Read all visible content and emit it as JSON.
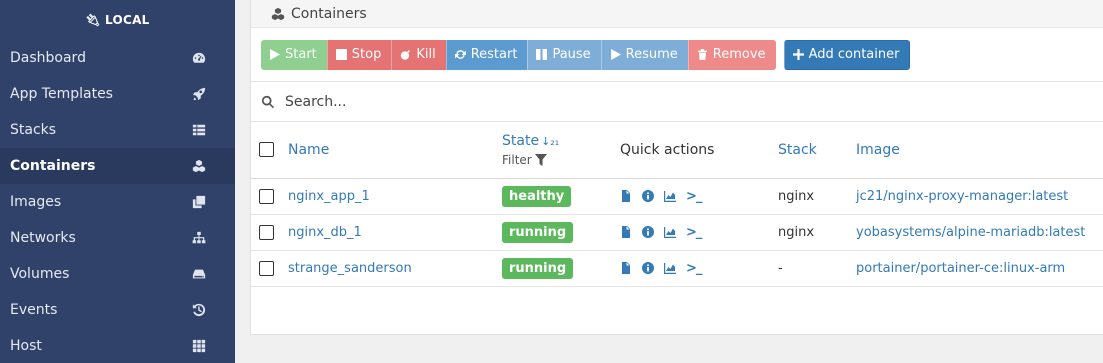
{
  "sidebar": {
    "endpoint": "LOCAL",
    "items": [
      {
        "label": "Dashboard",
        "icon": "dashboard-icon"
      },
      {
        "label": "App Templates",
        "icon": "rocket-icon"
      },
      {
        "label": "Stacks",
        "icon": "list-icon"
      },
      {
        "label": "Containers",
        "icon": "cubes-icon",
        "active": true
      },
      {
        "label": "Images",
        "icon": "clone-icon"
      },
      {
        "label": "Networks",
        "icon": "sitemap-icon"
      },
      {
        "label": "Volumes",
        "icon": "hdd-icon"
      },
      {
        "label": "Events",
        "icon": "history-icon"
      },
      {
        "label": "Host",
        "icon": "grid-icon"
      }
    ]
  },
  "widget": {
    "title": "Containers"
  },
  "actions": {
    "start": "Start",
    "stop": "Stop",
    "kill": "Kill",
    "restart": "Restart",
    "pause": "Pause",
    "resume": "Resume",
    "remove": "Remove",
    "add": "Add container"
  },
  "search": {
    "placeholder": "Search..."
  },
  "table": {
    "headers": {
      "name": "Name",
      "state": "State",
      "filter": "Filter",
      "quick_actions": "Quick actions",
      "stack": "Stack",
      "image": "Image"
    },
    "rows": [
      {
        "name": "nginx_app_1",
        "state": "healthy",
        "stack": "nginx",
        "image": "jc21/nginx-proxy-manager:latest"
      },
      {
        "name": "nginx_db_1",
        "state": "running",
        "stack": "nginx",
        "image": "yobasystems/alpine-mariadb:latest"
      },
      {
        "name": "strange_sanderson",
        "state": "running",
        "stack": "-",
        "image": "portainer/portainer-ce:linux-arm"
      }
    ]
  },
  "colors": {
    "sidebar_bg": "#30426a",
    "sidebar_active": "#2a3a5e",
    "link": "#337ab7",
    "badge_green": "#5cb85c"
  }
}
